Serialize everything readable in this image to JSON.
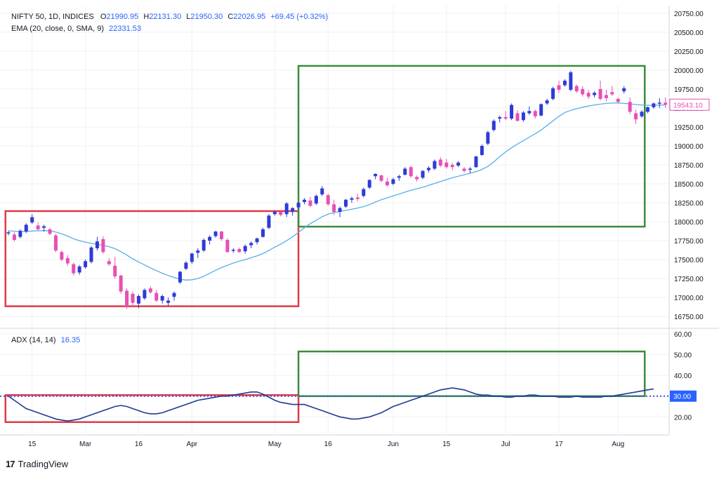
{
  "header": {
    "symbol": "NIFTY 50, 1D, INDICES",
    "open_label": "O",
    "open": "21990.95",
    "high_label": "H",
    "high": "22131.30",
    "low_label": "L",
    "low": "21950.30",
    "close_label": "C",
    "close": "22026.95",
    "change": "+69.45 (+0.32%)",
    "ema_label": "EMA (20, close, 0, SMA, 9)",
    "ema_value": "22331.53",
    "adx_label": "ADX (14, 14)",
    "adx_value": "16.35"
  },
  "branding": {
    "logo": "17",
    "name": "TradingView"
  },
  "colors": {
    "up": "#2e3bd6",
    "down": "#e84fb4",
    "ema": "#5aaee6",
    "adx": "#1f3a93",
    "red_box": "#e03a4a",
    "green_box": "#3b8c3b",
    "grid": "#eef0f3",
    "dotted_level": "#3d55e8",
    "price_tag": "#e84fb4",
    "adx_tag": "#2962ff"
  },
  "chart_data": [
    {
      "type": "candlestick",
      "panel": "price",
      "ylim": [
        16650,
        20850
      ],
      "yticks": [
        "20750.00",
        "20500.00",
        "20250.00",
        "20000.00",
        "19750.00",
        "19500.00",
        "19250.00",
        "19000.00",
        "18750.00",
        "18500.00",
        "18250.00",
        "18000.00",
        "17750.00",
        "17500.00",
        "17250.00",
        "17000.00",
        "16750.00"
      ],
      "last_price_label": "19543.10",
      "last_price": 19543.1,
      "series": [
        {
          "name": "NIFTY 50",
          "ohlc": [
            [
              17850,
              17880,
              17820,
              17860
            ],
            [
              17830,
              17860,
              17740,
              17760
            ],
            [
              17800,
              17900,
              17780,
              17880
            ],
            [
              17870,
              17980,
              17850,
              17960
            ],
            [
              17990,
              18100,
              17970,
              18060
            ],
            [
              17950,
              17990,
              17880,
              17900
            ],
            [
              17920,
              17960,
              17870,
              17940
            ],
            [
              17900,
              17920,
              17820,
              17840
            ],
            [
              17820,
              17840,
              17600,
              17620
            ],
            [
              17600,
              17620,
              17480,
              17500
            ],
            [
              17520,
              17560,
              17420,
              17450
            ],
            [
              17440,
              17460,
              17290,
              17320
            ],
            [
              17330,
              17430,
              17300,
              17410
            ],
            [
              17400,
              17500,
              17380,
              17480
            ],
            [
              17470,
              17680,
              17450,
              17660
            ],
            [
              17650,
              17800,
              17620,
              17740
            ],
            [
              17770,
              17810,
              17580,
              17600
            ],
            [
              17480,
              17520,
              17420,
              17440
            ],
            [
              17420,
              17540,
              17250,
              17280
            ],
            [
              17290,
              17300,
              17050,
              17080
            ],
            [
              17090,
              17120,
              16850,
              16880
            ],
            [
              17050,
              17080,
              16900,
              16930
            ],
            [
              16920,
              17040,
              16860,
              17020
            ],
            [
              16990,
              17120,
              16970,
              17100
            ],
            [
              17120,
              17150,
              17050,
              17070
            ],
            [
              17060,
              17100,
              16940,
              16960
            ],
            [
              16960,
              17040,
              16920,
              17020
            ],
            [
              16930,
              17000,
              16890,
              16960
            ],
            [
              17010,
              17080,
              16960,
              17060
            ],
            [
              17200,
              17350,
              17180,
              17340
            ],
            [
              17380,
              17480,
              17360,
              17460
            ],
            [
              17470,
              17590,
              17440,
              17580
            ],
            [
              17590,
              17650,
              17520,
              17620
            ],
            [
              17620,
              17780,
              17600,
              17760
            ],
            [
              17750,
              17820,
              17700,
              17800
            ],
            [
              17810,
              17880,
              17790,
              17870
            ],
            [
              17870,
              17880,
              17750,
              17770
            ],
            [
              17760,
              17780,
              17590,
              17600
            ],
            [
              17620,
              17650,
              17590,
              17630
            ],
            [
              17640,
              17660,
              17590,
              17600
            ],
            [
              17610,
              17700,
              17580,
              17680
            ],
            [
              17690,
              17740,
              17650,
              17720
            ],
            [
              17730,
              17790,
              17700,
              17780
            ],
            [
              17800,
              17920,
              17790,
              17900
            ],
            [
              17920,
              18100,
              17900,
              18080
            ],
            [
              18100,
              18150,
              18080,
              18130
            ],
            [
              18130,
              18140,
              18070,
              18090
            ],
            [
              18100,
              18260,
              18060,
              18240
            ],
            [
              18130,
              18190,
              18080,
              18180
            ],
            [
              18190,
              18260,
              18160,
              18250
            ],
            [
              18260,
              18310,
              18230,
              18290
            ],
            [
              18280,
              18330,
              18190,
              18210
            ],
            [
              18240,
              18360,
              18220,
              18340
            ],
            [
              18360,
              18470,
              18340,
              18440
            ],
            [
              18350,
              18370,
              18210,
              18230
            ],
            [
              18230,
              18290,
              18090,
              18130
            ],
            [
              18130,
              18200,
              18060,
              18180
            ],
            [
              18200,
              18300,
              18180,
              18290
            ],
            [
              18290,
              18330,
              18250,
              18310
            ],
            [
              18320,
              18370,
              18270,
              18300
            ],
            [
              18340,
              18450,
              18320,
              18430
            ],
            [
              18450,
              18560,
              18430,
              18550
            ],
            [
              18600,
              18640,
              18560,
              18630
            ],
            [
              18610,
              18620,
              18520,
              18540
            ],
            [
              18530,
              18580,
              18460,
              18480
            ],
            [
              18500,
              18580,
              18480,
              18560
            ],
            [
              18580,
              18620,
              18540,
              18600
            ],
            [
              18620,
              18720,
              18610,
              18700
            ],
            [
              18720,
              18740,
              18580,
              18600
            ],
            [
              18590,
              18610,
              18530,
              18560
            ],
            [
              18580,
              18680,
              18560,
              18670
            ],
            [
              18680,
              18730,
              18650,
              18710
            ],
            [
              18700,
              18820,
              18680,
              18800
            ],
            [
              18820,
              18850,
              18720,
              18740
            ],
            [
              18780,
              18830,
              18700,
              18720
            ],
            [
              18750,
              18780,
              18680,
              18720
            ],
            [
              18740,
              18800,
              18720,
              18780
            ],
            [
              18700,
              18720,
              18650,
              18670
            ],
            [
              18690,
              18720,
              18640,
              18700
            ],
            [
              18720,
              18870,
              18710,
              18860
            ],
            [
              18880,
              19020,
              18870,
              19000
            ],
            [
              19030,
              19200,
              19010,
              19180
            ],
            [
              19210,
              19350,
              19190,
              19330
            ],
            [
              19360,
              19400,
              19310,
              19380
            ],
            [
              19380,
              19460,
              19340,
              19360
            ],
            [
              19360,
              19560,
              19340,
              19540
            ],
            [
              19430,
              19470,
              19320,
              19330
            ],
            [
              19340,
              19460,
              19320,
              19440
            ],
            [
              19430,
              19520,
              19410,
              19460
            ],
            [
              19460,
              19480,
              19360,
              19390
            ],
            [
              19400,
              19560,
              19390,
              19550
            ],
            [
              19560,
              19620,
              19540,
              19600
            ],
            [
              19620,
              19780,
              19600,
              19760
            ],
            [
              19800,
              19860,
              19700,
              19740
            ],
            [
              19800,
              19880,
              19780,
              19860
            ],
            [
              19740,
              19990,
              19720,
              19970
            ],
            [
              19790,
              19810,
              19700,
              19720
            ],
            [
              19750,
              19790,
              19650,
              19680
            ],
            [
              19700,
              19740,
              19620,
              19650
            ],
            [
              19670,
              19720,
              19640,
              19700
            ],
            [
              19750,
              19860,
              19600,
              19620
            ],
            [
              19670,
              19740,
              19590,
              19630
            ],
            [
              19710,
              19790,
              19660,
              19680
            ],
            [
              19620,
              19640,
              19560,
              19580
            ],
            [
              19720,
              19790,
              19690,
              19760
            ],
            [
              19580,
              19640,
              19420,
              19450
            ],
            [
              19430,
              19480,
              19290,
              19350
            ],
            [
              19390,
              19470,
              19370,
              19450
            ],
            [
              19450,
              19520,
              19430,
              19510
            ],
            [
              19510,
              19570,
              19490,
              19560
            ],
            [
              19560,
              19630,
              19500,
              19570
            ],
            [
              19570,
              19640,
              19500,
              19543.1
            ]
          ]
        },
        {
          "name": "EMA (20, close, 0, SMA, 9)",
          "values": [
            17880,
            17875,
            17870,
            17872,
            17878,
            17880,
            17882,
            17880,
            17865,
            17840,
            17810,
            17775,
            17750,
            17730,
            17715,
            17700,
            17690,
            17670,
            17645,
            17605,
            17560,
            17510,
            17470,
            17430,
            17390,
            17355,
            17320,
            17290,
            17265,
            17240,
            17230,
            17235,
            17250,
            17280,
            17320,
            17360,
            17395,
            17425,
            17455,
            17480,
            17500,
            17525,
            17550,
            17580,
            17620,
            17665,
            17705,
            17750,
            17800,
            17860,
            17920,
            17975,
            18020,
            18065,
            18100,
            18120,
            18135,
            18150,
            18165,
            18180,
            18200,
            18225,
            18260,
            18290,
            18315,
            18340,
            18365,
            18390,
            18415,
            18435,
            18455,
            18480,
            18505,
            18530,
            18555,
            18580,
            18600,
            18620,
            18640,
            18660,
            18690,
            18730,
            18790,
            18860,
            18920,
            18975,
            19025,
            19070,
            19115,
            19160,
            19210,
            19270,
            19330,
            19390,
            19440,
            19470,
            19490,
            19510,
            19525,
            19540,
            19550,
            19560,
            19565,
            19565,
            19560,
            19555,
            19545,
            19540,
            19535,
            19535,
            19538,
            19540
          ]
        }
      ]
    },
    {
      "type": "line",
      "panel": "adx",
      "ylim": [
        12,
        62
      ],
      "yticks": [
        "60.00",
        "50.00",
        "40.00",
        "30.00",
        "20.00"
      ],
      "level_line": 30,
      "last_value_label": "30.00",
      "series": [
        {
          "name": "ADX (14, 14)",
          "values": [
            30,
            28,
            26,
            24,
            23,
            22,
            21,
            20,
            19,
            18.5,
            18,
            18.5,
            19,
            20,
            21,
            22,
            23,
            24,
            25,
            25.5,
            25,
            24,
            23,
            22,
            21.5,
            21.5,
            22,
            23,
            24,
            25,
            26,
            27,
            28,
            28.5,
            29,
            29.5,
            30,
            30,
            30.5,
            31,
            31.5,
            32,
            32,
            31,
            29.5,
            28,
            27,
            26.5,
            26,
            26,
            26,
            25,
            24,
            23,
            22,
            21,
            20,
            19.5,
            19,
            19,
            19.5,
            20,
            21,
            22,
            23.5,
            25,
            26,
            27,
            28,
            29,
            30,
            31,
            32,
            33,
            33.5,
            34,
            33.5,
            33,
            32,
            31,
            30.5,
            30.5,
            30,
            30,
            29.5,
            29.5,
            30,
            30,
            30.5,
            30.5,
            30,
            30,
            30,
            29.5,
            29.5,
            29.5,
            30,
            29.5,
            29.5,
            29.5,
            29.5,
            30,
            30,
            30.5,
            31,
            31.5,
            32,
            32.5,
            33,
            33.5
          ]
        }
      ]
    }
  ],
  "x_axis": {
    "labels": [
      {
        "text": "15",
        "index": 4
      },
      {
        "text": "Mar",
        "index": 13
      },
      {
        "text": "16",
        "index": 22
      },
      {
        "text": "Apr",
        "index": 31
      },
      {
        "text": "May",
        "index": 45
      },
      {
        "text": "16",
        "index": 54
      },
      {
        "text": "Jun",
        "index": 65
      },
      {
        "text": "15",
        "index": 74
      },
      {
        "text": "Jul",
        "index": 84
      },
      {
        "text": "17",
        "index": 93
      },
      {
        "text": "Aug",
        "index": 103
      }
    ]
  },
  "annotations": [
    {
      "name": "red-box-price",
      "panel": "price",
      "color": "red",
      "x0": -0.5,
      "x1": 49,
      "y0": 16885,
      "y1": 18140
    },
    {
      "name": "green-box-price",
      "panel": "price",
      "color": "green",
      "x0": 49,
      "x1": 107.5,
      "y0": 17935,
      "y1": 20055
    },
    {
      "name": "red-box-adx",
      "panel": "adx",
      "color": "red",
      "x0": -0.5,
      "x1": 49,
      "y0": 17.5,
      "y1": 30.5
    },
    {
      "name": "green-box-adx",
      "panel": "adx",
      "color": "green",
      "x0": 49,
      "x1": 107.5,
      "y0": 30,
      "y1": 51.5
    }
  ]
}
